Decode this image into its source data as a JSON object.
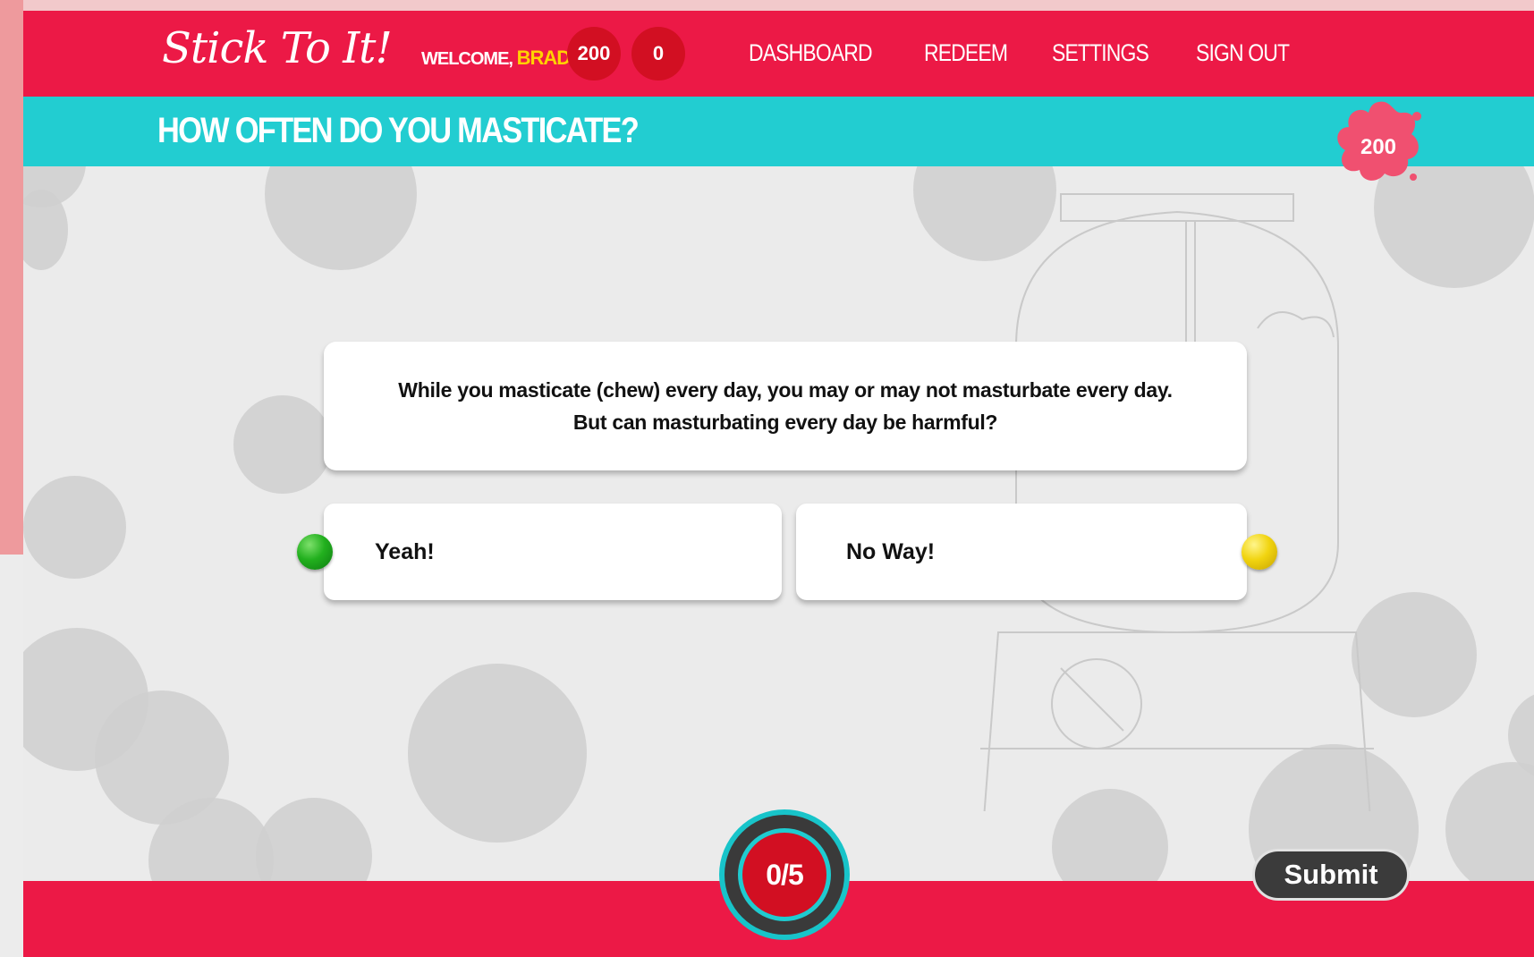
{
  "header": {
    "logo": "Stick To It!",
    "welcome_label": "WELCOME,",
    "user_name": "BRAD",
    "points": "200",
    "count": "0",
    "nav": [
      "DASHBOARD",
      "REDEEM",
      "SETTINGS",
      "SIGN OUT"
    ]
  },
  "question_bar": {
    "title": "HOW OFTEN DO YOU MASTICATE?",
    "badge_points": "200"
  },
  "prompt": {
    "line1": "While you masticate (chew) every day, you may or may not masturbate every day.",
    "line2": "But can masturbating every day be harmful?"
  },
  "answers": [
    {
      "label": "Yeah!",
      "indicator": "green-dot-icon",
      "color": "#22b01e"
    },
    {
      "label": "No Way!",
      "indicator": "yellow-dot-icon",
      "color": "#f1d410"
    }
  ],
  "footer": {
    "progress": "0/5",
    "submit_label": "Submit"
  },
  "colors": {
    "brand_red": "#ec1946",
    "accent_teal": "#22cdd1",
    "dark_button": "#3b3b3b"
  }
}
